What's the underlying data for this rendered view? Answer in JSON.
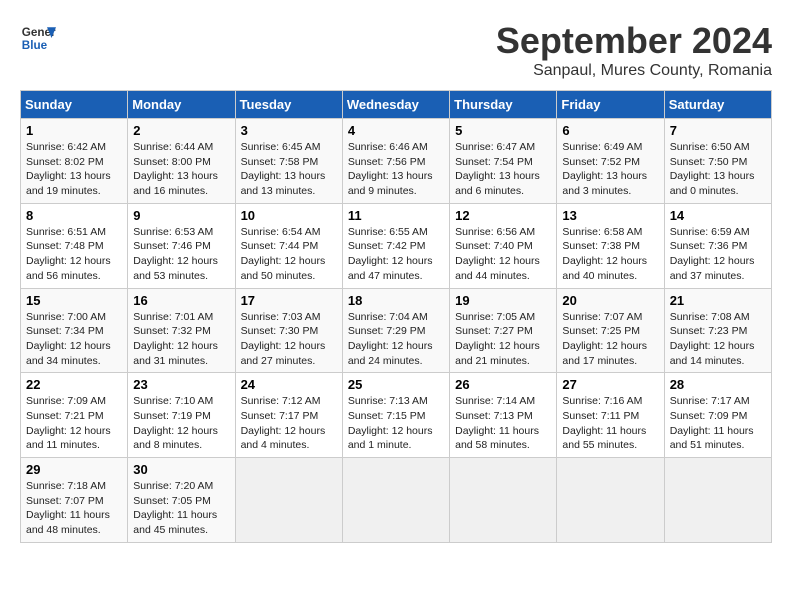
{
  "logo": {
    "line1": "General",
    "line2": "Blue"
  },
  "title": "September 2024",
  "subtitle": "Sanpaul, Mures County, Romania",
  "columns": [
    "Sunday",
    "Monday",
    "Tuesday",
    "Wednesday",
    "Thursday",
    "Friday",
    "Saturday"
  ],
  "weeks": [
    [
      {
        "day": "1",
        "detail": "Sunrise: 6:42 AM\nSunset: 8:02 PM\nDaylight: 13 hours\nand 19 minutes."
      },
      {
        "day": "2",
        "detail": "Sunrise: 6:44 AM\nSunset: 8:00 PM\nDaylight: 13 hours\nand 16 minutes."
      },
      {
        "day": "3",
        "detail": "Sunrise: 6:45 AM\nSunset: 7:58 PM\nDaylight: 13 hours\nand 13 minutes."
      },
      {
        "day": "4",
        "detail": "Sunrise: 6:46 AM\nSunset: 7:56 PM\nDaylight: 13 hours\nand 9 minutes."
      },
      {
        "day": "5",
        "detail": "Sunrise: 6:47 AM\nSunset: 7:54 PM\nDaylight: 13 hours\nand 6 minutes."
      },
      {
        "day": "6",
        "detail": "Sunrise: 6:49 AM\nSunset: 7:52 PM\nDaylight: 13 hours\nand 3 minutes."
      },
      {
        "day": "7",
        "detail": "Sunrise: 6:50 AM\nSunset: 7:50 PM\nDaylight: 13 hours\nand 0 minutes."
      }
    ],
    [
      {
        "day": "8",
        "detail": "Sunrise: 6:51 AM\nSunset: 7:48 PM\nDaylight: 12 hours\nand 56 minutes."
      },
      {
        "day": "9",
        "detail": "Sunrise: 6:53 AM\nSunset: 7:46 PM\nDaylight: 12 hours\nand 53 minutes."
      },
      {
        "day": "10",
        "detail": "Sunrise: 6:54 AM\nSunset: 7:44 PM\nDaylight: 12 hours\nand 50 minutes."
      },
      {
        "day": "11",
        "detail": "Sunrise: 6:55 AM\nSunset: 7:42 PM\nDaylight: 12 hours\nand 47 minutes."
      },
      {
        "day": "12",
        "detail": "Sunrise: 6:56 AM\nSunset: 7:40 PM\nDaylight: 12 hours\nand 44 minutes."
      },
      {
        "day": "13",
        "detail": "Sunrise: 6:58 AM\nSunset: 7:38 PM\nDaylight: 12 hours\nand 40 minutes."
      },
      {
        "day": "14",
        "detail": "Sunrise: 6:59 AM\nSunset: 7:36 PM\nDaylight: 12 hours\nand 37 minutes."
      }
    ],
    [
      {
        "day": "15",
        "detail": "Sunrise: 7:00 AM\nSunset: 7:34 PM\nDaylight: 12 hours\nand 34 minutes."
      },
      {
        "day": "16",
        "detail": "Sunrise: 7:01 AM\nSunset: 7:32 PM\nDaylight: 12 hours\nand 31 minutes."
      },
      {
        "day": "17",
        "detail": "Sunrise: 7:03 AM\nSunset: 7:30 PM\nDaylight: 12 hours\nand 27 minutes."
      },
      {
        "day": "18",
        "detail": "Sunrise: 7:04 AM\nSunset: 7:29 PM\nDaylight: 12 hours\nand 24 minutes."
      },
      {
        "day": "19",
        "detail": "Sunrise: 7:05 AM\nSunset: 7:27 PM\nDaylight: 12 hours\nand 21 minutes."
      },
      {
        "day": "20",
        "detail": "Sunrise: 7:07 AM\nSunset: 7:25 PM\nDaylight: 12 hours\nand 17 minutes."
      },
      {
        "day": "21",
        "detail": "Sunrise: 7:08 AM\nSunset: 7:23 PM\nDaylight: 12 hours\nand 14 minutes."
      }
    ],
    [
      {
        "day": "22",
        "detail": "Sunrise: 7:09 AM\nSunset: 7:21 PM\nDaylight: 12 hours\nand 11 minutes."
      },
      {
        "day": "23",
        "detail": "Sunrise: 7:10 AM\nSunset: 7:19 PM\nDaylight: 12 hours\nand 8 minutes."
      },
      {
        "day": "24",
        "detail": "Sunrise: 7:12 AM\nSunset: 7:17 PM\nDaylight: 12 hours\nand 4 minutes."
      },
      {
        "day": "25",
        "detail": "Sunrise: 7:13 AM\nSunset: 7:15 PM\nDaylight: 12 hours\nand 1 minute."
      },
      {
        "day": "26",
        "detail": "Sunrise: 7:14 AM\nSunset: 7:13 PM\nDaylight: 11 hours\nand 58 minutes."
      },
      {
        "day": "27",
        "detail": "Sunrise: 7:16 AM\nSunset: 7:11 PM\nDaylight: 11 hours\nand 55 minutes."
      },
      {
        "day": "28",
        "detail": "Sunrise: 7:17 AM\nSunset: 7:09 PM\nDaylight: 11 hours\nand 51 minutes."
      }
    ],
    [
      {
        "day": "29",
        "detail": "Sunrise: 7:18 AM\nSunset: 7:07 PM\nDaylight: 11 hours\nand 48 minutes."
      },
      {
        "day": "30",
        "detail": "Sunrise: 7:20 AM\nSunset: 7:05 PM\nDaylight: 11 hours\nand 45 minutes."
      },
      null,
      null,
      null,
      null,
      null
    ]
  ]
}
